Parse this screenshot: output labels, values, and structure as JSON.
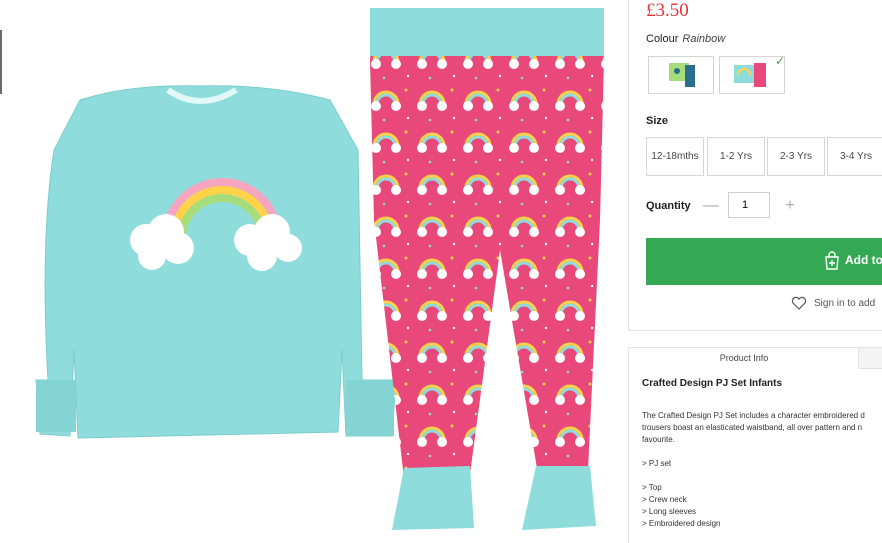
{
  "product": {
    "price": "£3.50",
    "colour_label": "Colour",
    "colour_value": "Rainbow",
    "swatches": [
      {
        "name": "dinosaur-pj",
        "selected": false
      },
      {
        "name": "rainbow-pj",
        "selected": true
      }
    ],
    "size_label": "Size",
    "sizes": [
      "12-18mths",
      "1-2 Yrs",
      "2-3 Yrs",
      "3-4 Yrs"
    ],
    "quantity_label": "Quantity",
    "quantity_value": "1",
    "add_button_label": "Add to",
    "wishlist_text": "Sign in to add"
  },
  "info": {
    "tab_label": "Product Info",
    "title": "Crafted Design PJ Set Infants",
    "description_lines": [
      "The Crafted Design PJ Set includes a character embroidered d",
      "trousers boast an elasticated waistband, all over pattern and n",
      "favourite."
    ],
    "bullets": [
      "> PJ set",
      "> Top",
      "> Crew neck",
      "> Long sleeves",
      "> Embroidered design"
    ]
  },
  "colors": {
    "price": "#e2333b",
    "add_button": "#34a853",
    "top": "#8fdcdc",
    "trousers": "#e8487a",
    "cuff": "#8fdcdc"
  }
}
